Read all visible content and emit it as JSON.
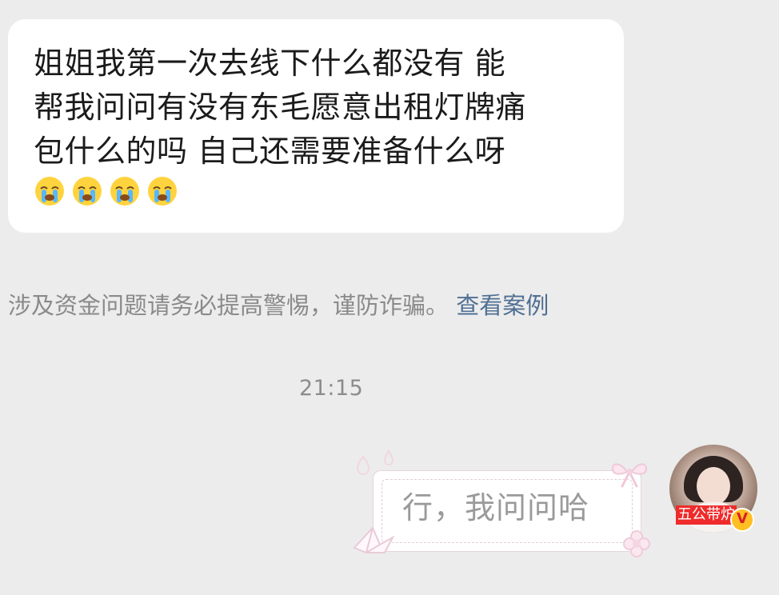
{
  "messages": {
    "incoming": {
      "lines": [
        "姐姐我第一次去线下什么都没有 能",
        "帮我问问有没有东毛愿意出租灯牌痛",
        "包什么的吗 自己还需要准备什么呀"
      ],
      "emojis": [
        "loudly-crying-face-icon",
        "loudly-crying-face-icon",
        "loudly-crying-face-icon",
        "loudly-crying-face-icon"
      ]
    },
    "warning": {
      "text": "涉及资金问题请务必提高警惕，谨防诈骗。",
      "link": "查看案例"
    },
    "timestamp": "21:15",
    "outgoing": {
      "text": "行，我问问哈"
    }
  },
  "avatar": {
    "badge_text": "五公带炉",
    "verified_symbol": "V"
  },
  "colors": {
    "background": "#ececec",
    "bubble": "#ffffff",
    "link": "#4f6f93",
    "warning": "#8a8a8a",
    "timestamp": "#8c8c8c",
    "badge": "#ef2b2b"
  }
}
